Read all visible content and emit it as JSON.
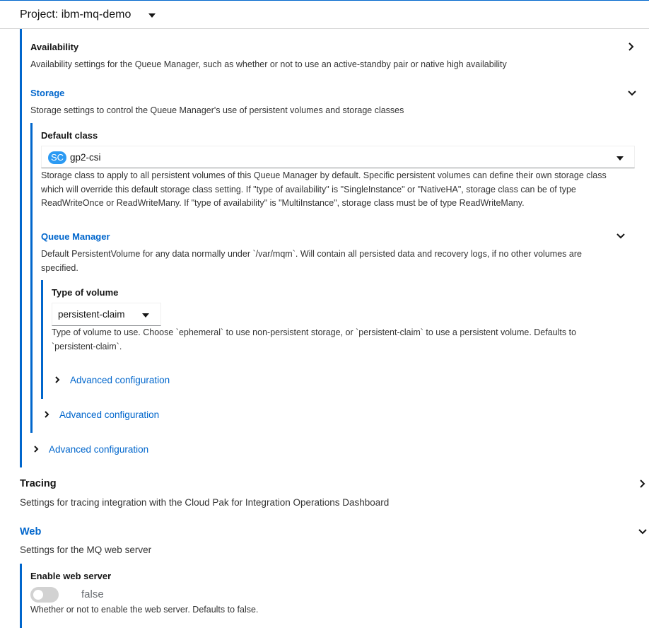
{
  "project": {
    "label": "Project: ibm-mq-demo"
  },
  "availability": {
    "title": "Availability",
    "description": "Availability settings for the Queue Manager, such as whether or not to use an active-standby pair or native high availability"
  },
  "storage": {
    "title": "Storage",
    "description": "Storage settings to control the Queue Manager's use of persistent volumes and storage classes",
    "default_class": {
      "label": "Default class",
      "badge": "SC",
      "value": "gp2-csi",
      "help_lines": [
        "Storage class to apply to all persistent volumes of this Queue Manager by default. Specific persistent volumes can define their own storage class",
        "which will override this default storage class setting. If \"type of availability\" is \"SingleInstance\" or \"NativeHA\", storage class can be of type",
        "ReadWriteOnce or ReadWriteMany. If \"type of availability\" is \"MultiInstance\", storage class must be of type ReadWriteMany."
      ]
    },
    "queue_manager": {
      "title": "Queue Manager",
      "description_lines": [
        "Default PersistentVolume for any data normally under `/var/mqm`. Will contain all persisted data and recovery logs, if no other volumes are",
        "specified."
      ],
      "type_of_volume": {
        "label": "Type of volume",
        "value": "persistent-claim",
        "help_lines": [
          "Type of volume to use. Choose `ephemeral` to use non-persistent storage, or `persistent-claim` to use a persistent volume. Defaults to",
          "`persistent-claim`."
        ]
      },
      "advanced_inner": "Advanced configuration",
      "advanced_outer": "Advanced configuration"
    },
    "advanced": "Advanced configuration"
  },
  "tracing": {
    "title": "Tracing",
    "description": "Settings for tracing integration with the Cloud Pak for Integration Operations Dashboard"
  },
  "web": {
    "title": "Web",
    "description": "Settings for the MQ web server",
    "enable": {
      "label": "Enable web server",
      "value": "false",
      "help": "Whether or not to enable the web server. Defaults to false."
    }
  },
  "colors": {
    "accent": "#0066cc",
    "badge": "#2b9af3",
    "toggle_off": "#d2d2d2"
  }
}
